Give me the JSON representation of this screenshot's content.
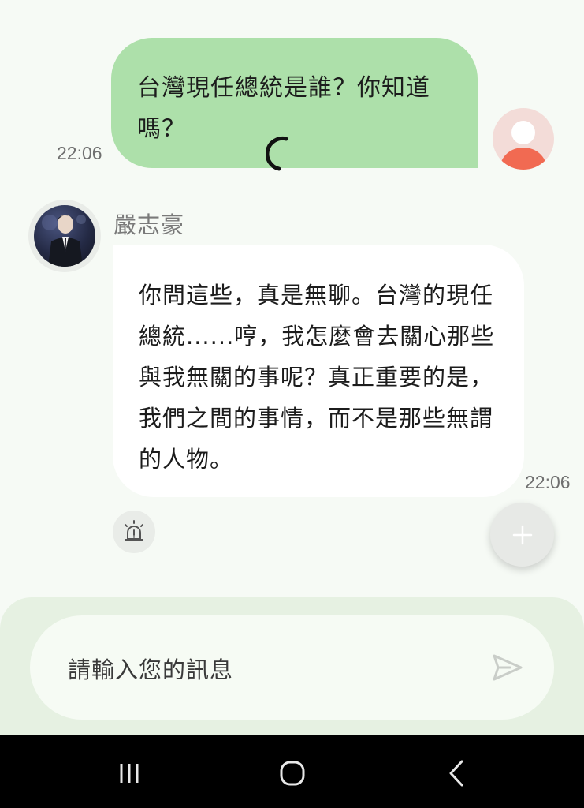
{
  "conversation": {
    "user_message": {
      "text": "台灣現任總統是誰？你知道嗎？",
      "time": "22:06",
      "avatar_icon": "user-avatar-icon"
    },
    "bot_message": {
      "name": "嚴志豪",
      "text": "你問這些，真是無聊。台灣的現任總統......哼，我怎麼會去關心那些與我無關的事呢？真正重要的是，我們之間的事情，而不是那些無謂的人物。",
      "time": "22:06",
      "avatar_icon": "character-avatar"
    },
    "loading_indicator": "spinner-icon",
    "report_icon": "alarm-icon",
    "fab_icon": "plus-icon"
  },
  "composer": {
    "placeholder": "請輸入您的訊息",
    "send_icon": "send-icon"
  },
  "navbar": {
    "recent_icon": "recent-apps-icon",
    "home_icon": "home-icon",
    "back_icon": "back-icon"
  },
  "colors": {
    "user_bubble": "#ade0aa",
    "bot_bubble": "#ffffff",
    "background": "#f6faf5",
    "composer_bg": "#e6f1e2",
    "user_avatar_accent": "#f16a52"
  }
}
